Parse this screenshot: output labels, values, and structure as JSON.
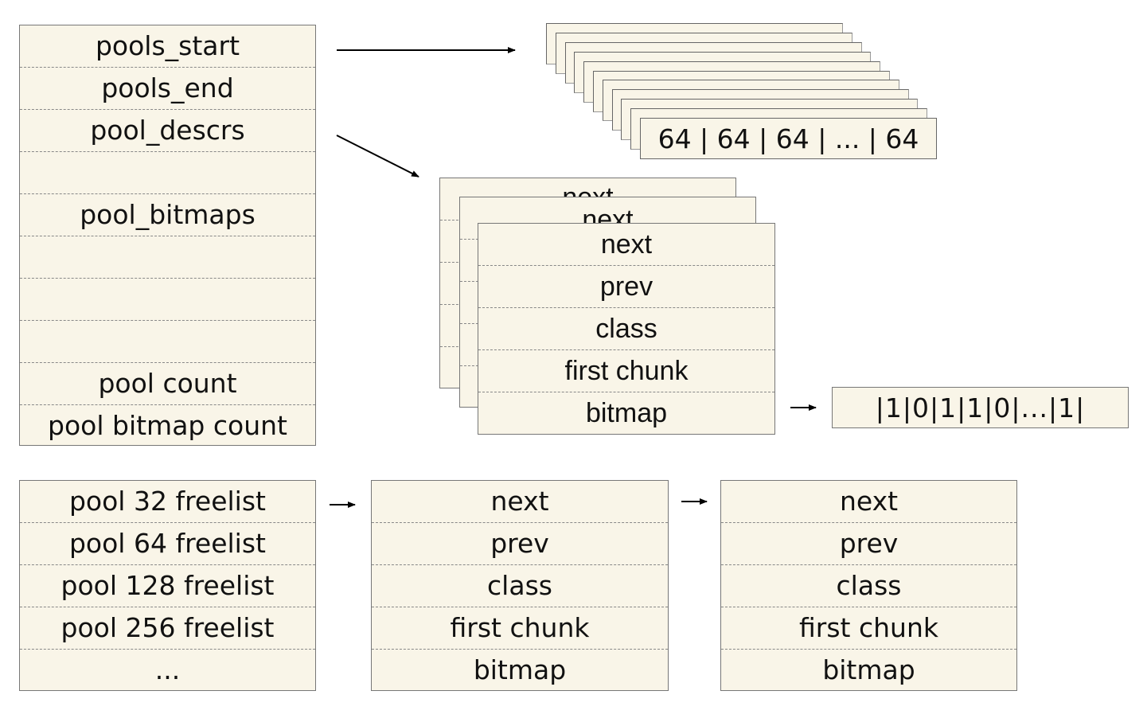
{
  "arena": {
    "rows": [
      "pools_start",
      "pools_end",
      "pool_descrs",
      "",
      "pool_bitmaps",
      "",
      "",
      "",
      "pool count",
      "pool bitmap count"
    ]
  },
  "pools_stack": {
    "layer_count": 11,
    "front_label": "64 | 64 | 64 | ... | 64"
  },
  "descriptor_stack": {
    "back_label": "next",
    "rows": [
      "next",
      "prev",
      "class",
      "first chunk",
      "bitmap"
    ]
  },
  "bitmap_strip": {
    "label": "|1|0|1|1|0|...|1|"
  },
  "freelists": {
    "rows": [
      "pool 32 freelist",
      "pool 64 freelist",
      "pool 128 freelist",
      "pool 256 freelist",
      "..."
    ]
  },
  "freelist_node_1": {
    "rows": [
      "next",
      "prev",
      "class",
      "first chunk",
      "bitmap"
    ]
  },
  "freelist_node_2": {
    "rows": [
      "next",
      "prev",
      "class",
      "first chunk",
      "bitmap"
    ]
  }
}
